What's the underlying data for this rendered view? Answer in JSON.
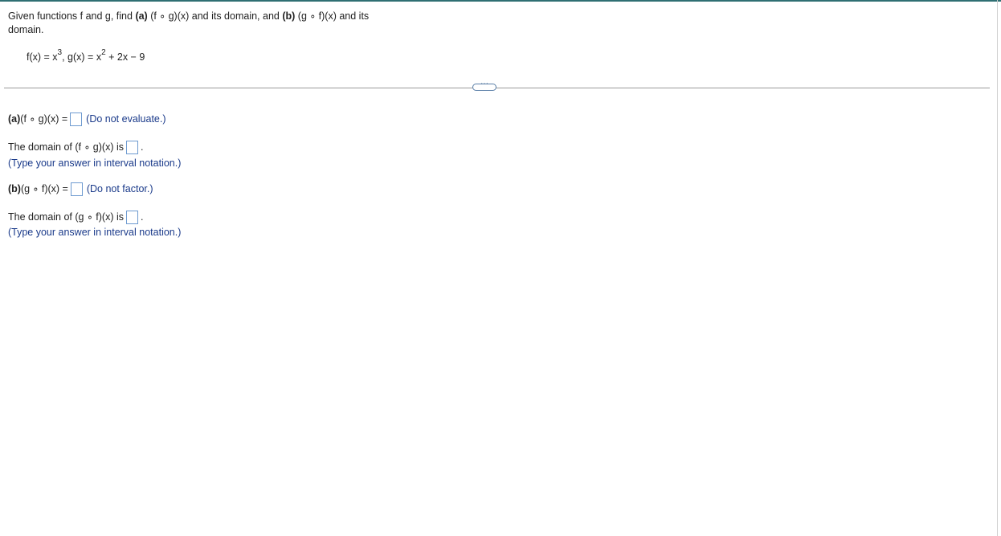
{
  "question": {
    "pre": "Given functions f and g, find ",
    "part_a_label": "(a)",
    "part_a_expr": " (f ∘ g)(x) and its domain, and ",
    "part_b_label": "(b)",
    "part_b_expr": " (g ∘ f)(x) and its domain."
  },
  "formula": {
    "f_lhs": "f(x) = x",
    "f_exp": "3",
    "sep": ", g(x) = x",
    "g_exp": "2",
    "g_rest": " + 2x − 9"
  },
  "divider": {
    "more_button": "⋯"
  },
  "part_a": {
    "label": "(a)",
    "expr": " (f ∘ g)(x) =",
    "answer_value": "",
    "hint": "(Do not evaluate.)"
  },
  "domain_a": {
    "text": "The domain of (f ∘ g)(x) is",
    "answer_value": "",
    "period": ".",
    "hint": "(Type your answer in interval notation.)"
  },
  "part_b": {
    "label": "(b)",
    "expr": " (g ∘ f)(x) =",
    "answer_value": "",
    "hint": "(Do not factor.)"
  },
  "domain_b": {
    "text": "The domain of (g ∘ f)(x) is",
    "answer_value": "",
    "period": ".",
    "hint": "(Type your answer in interval notation.)"
  },
  "colors": {
    "hint_text": "#1a3a8a",
    "answer_box_border": "#6d9ad0",
    "top_border": "#2f6f73"
  }
}
